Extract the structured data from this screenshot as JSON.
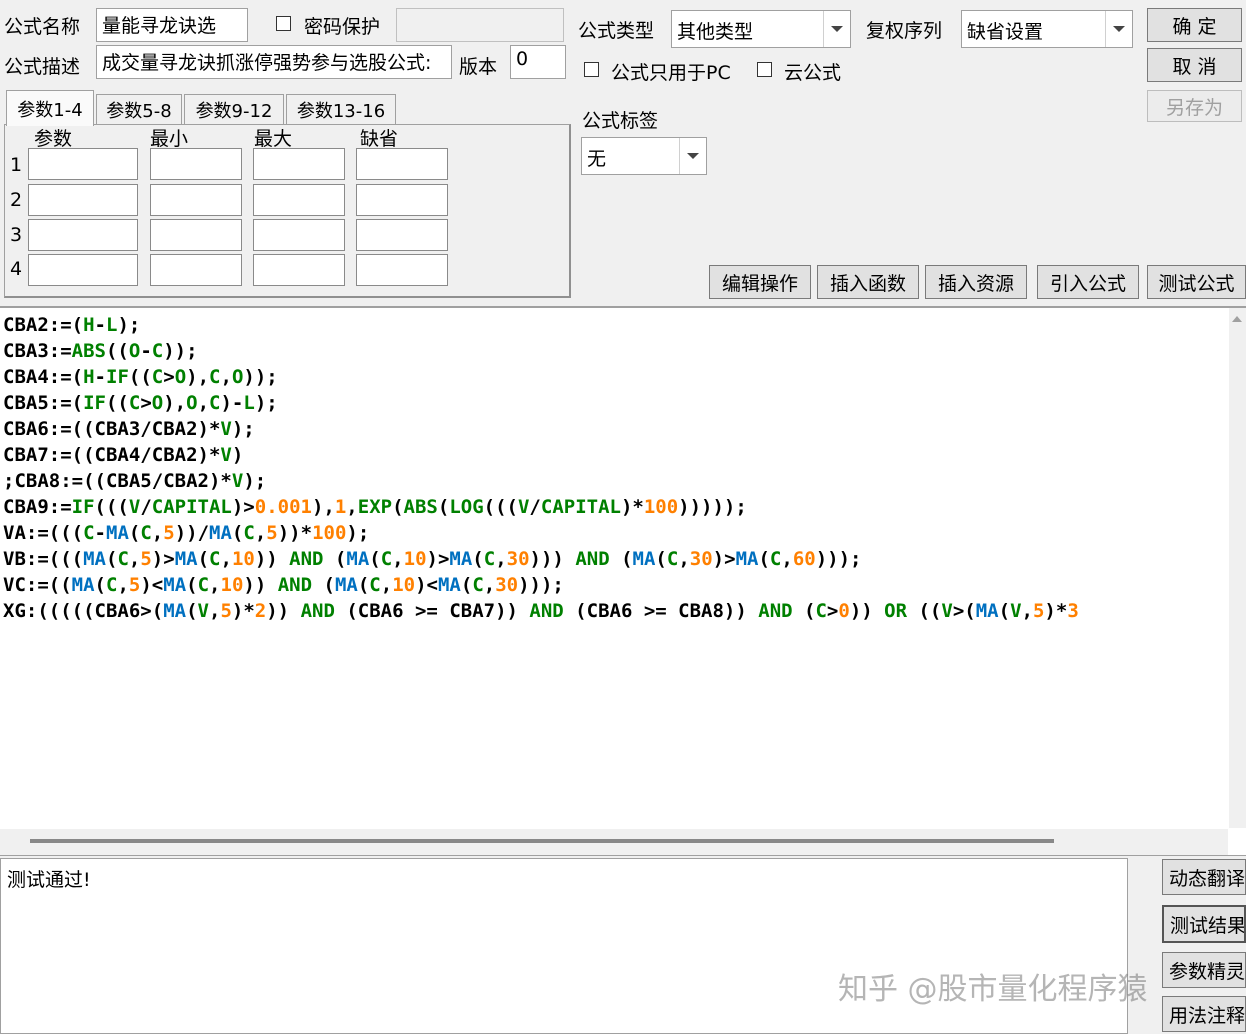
{
  "header": {
    "name_label": "公式名称",
    "name_value": "量能寻龙诀选",
    "password_label": "密码保护",
    "password_checked": false,
    "password_value": "",
    "desc_label": "公式描述",
    "desc_value": "成交量寻龙诀抓涨停强势参与选股公式:",
    "version_label": "版本",
    "version_value": "0",
    "type_label": "公式类型",
    "type_value": "其他类型",
    "rights_label": "复权序列",
    "rights_value": "缺省设置",
    "pc_only_label": "公式只用于PC",
    "pc_only_checked": false,
    "cloud_label": "云公式",
    "cloud_checked": false,
    "tag_label": "公式标签",
    "tag_value": "无"
  },
  "buttons": {
    "ok": "确  定",
    "cancel": "取  消",
    "save_as": "另存为",
    "edit_ops": "编辑操作",
    "insert_func": "插入函数",
    "insert_res": "插入资源",
    "import_formula": "引入公式",
    "test_formula": "测试公式"
  },
  "params": {
    "tabs": [
      "参数1-4",
      "参数5-8",
      "参数9-12",
      "参数13-16"
    ],
    "active_tab": 0,
    "headers": [
      "参数",
      "最小",
      "最大",
      "缺省"
    ],
    "rows": [
      "1",
      "2",
      "3",
      "4"
    ]
  },
  "colors": {
    "text": "#000000",
    "func": "#008000",
    "num": "#ff8000",
    "ma": "#0070c0"
  },
  "code_lines": [
    "CBA2:=(H-L);",
    "CBA3:=ABS((O-C));",
    "CBA4:=(H-IF((C>O),C,O));",
    "CBA5:=(IF((C>O),O,C)-L);",
    "CBA6:=((CBA3/CBA2)*V);",
    "CBA7:=((CBA4/CBA2)*V)",
    ";CBA8:=((CBA5/CBA2)*V);",
    "CBA9:=IF(((V/CAPITAL)>0.001),1,EXP(ABS(LOG(((V/CAPITAL)*100)))));",
    "VA:=(((C-MA(C,5))/MA(C,5))*100);",
    "VB:=(((MA(C,5)>MA(C,10)) AND (MA(C,10)>MA(C,30))) AND (MA(C,30)>MA(C,60)));",
    "VC:=((MA(C,5)<MA(C,10)) AND (MA(C,10)<MA(C,30)));",
    "XG:(((((CBA6>(MA(V,5)*2)) AND (CBA6 >= CBA7)) AND (CBA6 >= CBA8)) AND (C>0)) OR ((V>(MA(V,5)*3"
  ],
  "output": {
    "message": "测试通过!"
  },
  "side_buttons": [
    "动态翻译",
    "测试结果",
    "参数精灵",
    "用法注释"
  ],
  "watermark": "知乎 @股市量化程序猿"
}
